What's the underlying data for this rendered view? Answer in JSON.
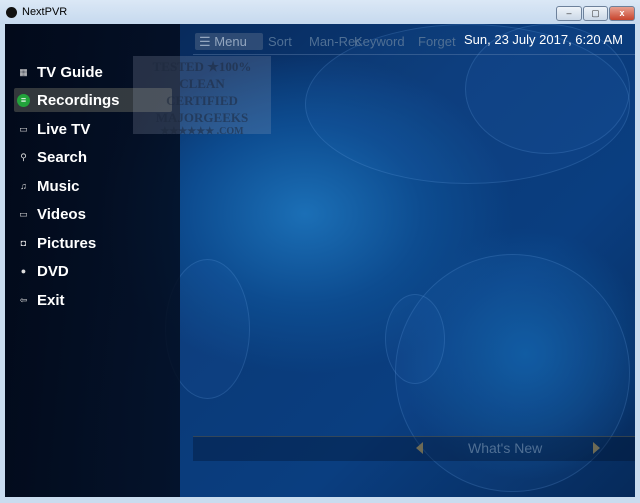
{
  "window": {
    "title": "NextPVR",
    "minimize": "–",
    "maximize": "▢",
    "close": "x"
  },
  "topbar": {
    "menu_icon": "☰",
    "menu_label": "Menu",
    "actions": [
      "Sort",
      "Man-Rec",
      "Keyword",
      "Forget"
    ],
    "datetime": "Sun, 23 July 2017, 6:20 AM"
  },
  "sidebar": {
    "selected": "Recordings",
    "items": [
      {
        "label": "TV Guide",
        "icon": "grid-icon",
        "glyph": "▦"
      },
      {
        "label": "Recordings",
        "icon": "list-icon",
        "glyph": "≡"
      },
      {
        "label": "Live TV",
        "icon": "tv-icon",
        "glyph": "▭"
      },
      {
        "label": "Search",
        "icon": "search-icon",
        "glyph": "⚲"
      },
      {
        "label": "Music",
        "icon": "music-icon",
        "glyph": "♫"
      },
      {
        "label": "Videos",
        "icon": "film-icon",
        "glyph": "▭"
      },
      {
        "label": "Pictures",
        "icon": "camera-icon",
        "glyph": "◘"
      },
      {
        "label": "DVD",
        "icon": "disc-icon",
        "glyph": "●"
      },
      {
        "label": "Exit",
        "icon": "exit-icon",
        "glyph": "⇦"
      }
    ]
  },
  "watermark": {
    "line1": "TESTED ★100% CLEAN",
    "line2": "CERTIFIED",
    "line3": "MAJORGEEKS",
    "line4": "★★★★★★ .COM"
  },
  "footer": {
    "label": "What's New"
  },
  "colors": {
    "accent_selected": "#22a33b",
    "background": "#0a3a78"
  }
}
